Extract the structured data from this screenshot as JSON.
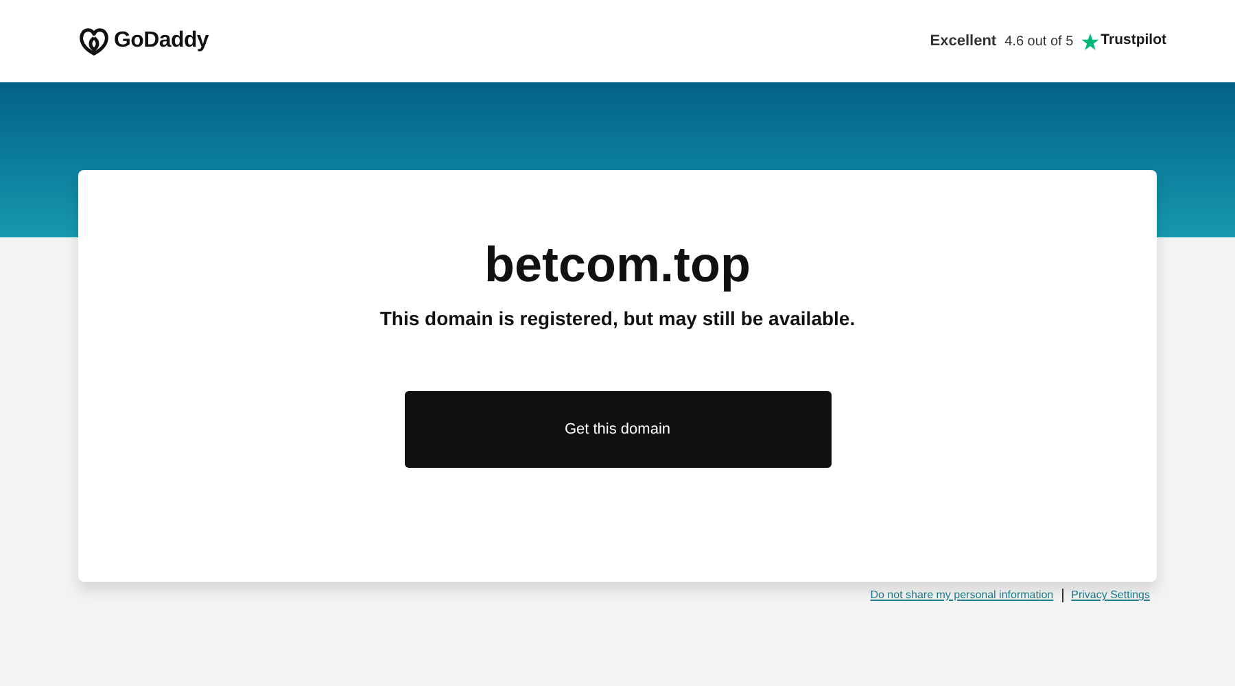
{
  "header": {
    "logo": "GoDaddy",
    "rating": {
      "label": "Excellent",
      "score": "4.6 out of 5",
      "brand": "Trustpilot"
    }
  },
  "card": {
    "domain": "betcom.top",
    "message": "This domain is registered, but may still be available.",
    "button": "Get this domain"
  },
  "footer_links": [
    "Do not share my personal information",
    "Privacy Settings"
  ]
}
